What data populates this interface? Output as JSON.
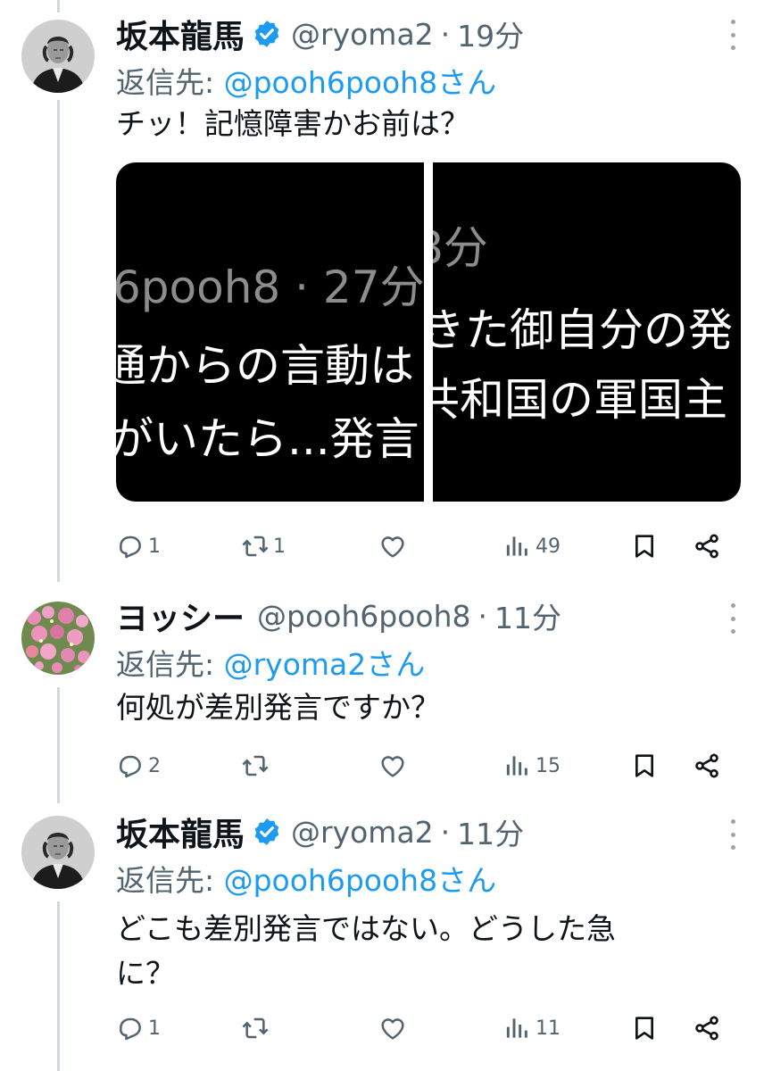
{
  "tweets": [
    {
      "display_name": "坂本龍馬",
      "handle": "@ryoma2",
      "time": "19分",
      "reply_prefix": "返信先: ",
      "reply_mention": "@pooh6pooh8さん",
      "text": "チッ！記憶障害かお前は？",
      "avatar": "samurai-portrait",
      "verified": true,
      "media": {
        "left_lines": [
          "6pooh8 · 27分",
          "通からの言動は",
          "がいたら...発言"
        ],
        "right_lines": [
          "8分",
          "きた御自分の発",
          "共和国の軍国主"
        ]
      },
      "stats": {
        "replies": "1",
        "reposts": "1",
        "likes": "",
        "views": "49"
      }
    },
    {
      "display_name": "ヨッシー",
      "handle": "@pooh6pooh8",
      "time": "11分",
      "reply_prefix": "返信先: ",
      "reply_mention": "@ryoma2さん",
      "text": "何処が差別発言ですか？",
      "avatar": "pink-flowers",
      "verified": false,
      "stats": {
        "replies": "2",
        "reposts": "",
        "likes": "",
        "views": "15"
      }
    },
    {
      "display_name": "坂本龍馬",
      "handle": "@ryoma2",
      "time": "11分",
      "reply_prefix": "返信先: ",
      "reply_mention": "@pooh6pooh8さん",
      "text_line1": "どこも差別発言ではない。どうした急",
      "text_line2": "に？",
      "avatar": "samurai-portrait",
      "verified": true,
      "stats": {
        "replies": "1",
        "reposts": "",
        "likes": "",
        "views": "11"
      }
    }
  ],
  "separator_dot": "·",
  "colors": {
    "accent": "#1d9bf0",
    "muted": "#536471",
    "text": "#0f1419",
    "thread_line": "#cfd9de"
  },
  "icons": [
    "reply-icon",
    "repost-icon",
    "like-icon",
    "views-icon",
    "bookmark-icon",
    "share-icon",
    "more-icon",
    "verified-badge-icon"
  ]
}
